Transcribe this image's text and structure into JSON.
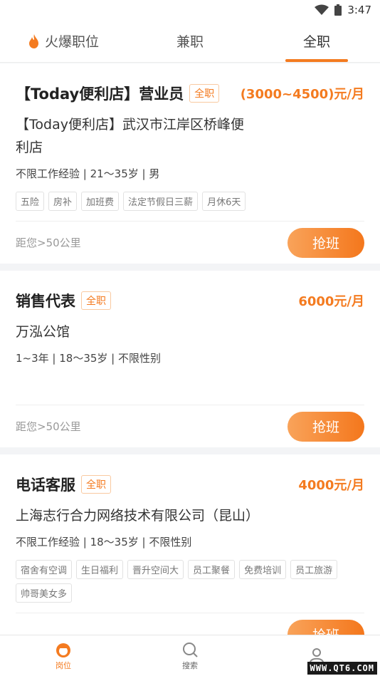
{
  "status_bar": {
    "time": "3:47"
  },
  "tabs": [
    {
      "label": "火爆职位",
      "icon": "fire-icon",
      "active": false
    },
    {
      "label": "兼职",
      "active": false
    },
    {
      "label": "全职",
      "active": true
    }
  ],
  "jobs": [
    {
      "title": "【Today便利店】营业员",
      "type": "全职",
      "salary": "(3000~4500)元/月",
      "company": "【Today便利店】武汉市江岸区桥峰便利店",
      "requirements": "不限工作经验 | 21〜35岁 | 男",
      "tags": [
        "五险",
        "房补",
        "加班费",
        "法定节假日三薪",
        "月休6天"
      ],
      "distance": "距您>50公里",
      "button": "抢班"
    },
    {
      "title": "销售代表",
      "type": "全职",
      "salary": "6000元/月",
      "company": "万泓公馆",
      "requirements": "1~3年 | 18〜35岁 | 不限性别",
      "tags": [],
      "distance": "距您>50公里",
      "button": "抢班"
    },
    {
      "title": "电话客服",
      "type": "全职",
      "salary": "4000元/月",
      "company": "上海志行合力网络技术有限公司（昆山）",
      "requirements": "不限工作经验 | 18〜35岁 | 不限性别",
      "tags": [
        "宿舍有空调",
        "生日福利",
        "晋升空间大",
        "员工聚餐",
        "免费培训",
        "员工旅游",
        "帅哥美女多"
      ],
      "distance": "",
      "button": "抢班"
    }
  ],
  "bottom_nav": [
    {
      "label": "岗位",
      "icon": "job-icon",
      "active": true
    },
    {
      "label": "搜索",
      "icon": "search-icon",
      "active": false
    },
    {
      "label": "",
      "icon": "profile-icon",
      "active": false
    }
  ],
  "watermark": "WWW.QT6.COM",
  "colors": {
    "accent": "#f47b20",
    "accent_light": "#f9a35a"
  }
}
